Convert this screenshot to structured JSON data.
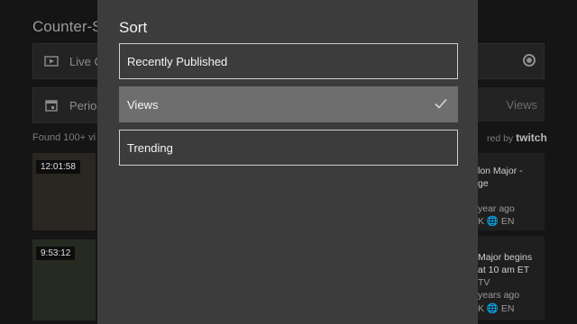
{
  "background": {
    "title": "Counter-S",
    "rows": [
      {
        "icon": "live-icon",
        "text": "Live C"
      },
      {
        "icon": "calendar-icon",
        "text": "Perio"
      }
    ],
    "views_label": "Views",
    "found_text": "Found 100+ vi",
    "powered_prefix": "red by",
    "powered_brand": "twitch",
    "videos": [
      {
        "duration": "12:01:58",
        "title_line1": "lon Major -",
        "title_line2": "ge",
        "meta1": "year ago",
        "meta2": "K 🌐 EN"
      },
      {
        "duration": "9:53:12",
        "title_line1": "Major begins",
        "title_line2": "at 10 am ET",
        "meta1": "TV",
        "meta2": "years ago",
        "meta3": "K 🌐 EN"
      }
    ]
  },
  "modal": {
    "title": "Sort",
    "options": [
      {
        "label": "Recently Published",
        "selected": false
      },
      {
        "label": "Views",
        "selected": true
      },
      {
        "label": "Trending",
        "selected": false
      }
    ]
  },
  "colors": {
    "sheet": "#3c3c3c",
    "selected": "#6e6e6e",
    "border": "#cfcfcf"
  }
}
